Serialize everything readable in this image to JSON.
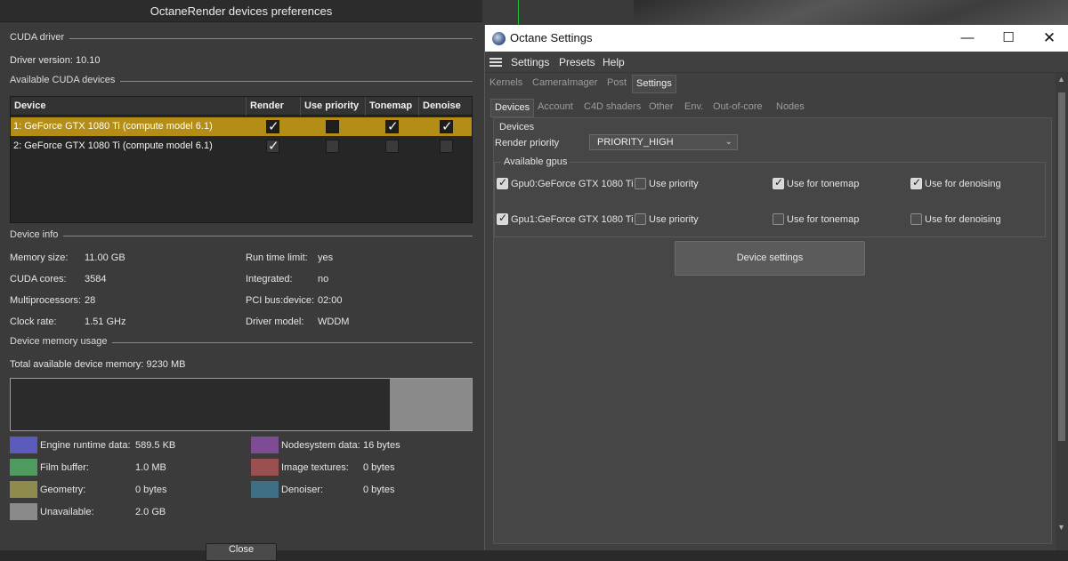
{
  "left_dialog": {
    "title": "OctaneRender devices preferences",
    "sections": {
      "cuda_driver": "CUDA driver",
      "available_devices": "Available CUDA devices",
      "device_info": "Device info",
      "memory_usage": "Device memory usage"
    },
    "driver_version": "Driver version:  10.10",
    "table": {
      "headers": [
        "Device",
        "Render",
        "Use priority",
        "Tonemap",
        "Denoise"
      ],
      "rows": [
        {
          "name": "1: GeForce GTX 1080 Ti (compute model 6.1)",
          "render": true,
          "priority": false,
          "tonemap": true,
          "denoise": true,
          "selected": true
        },
        {
          "name": "2: GeForce GTX 1080 Ti (compute model 6.1)",
          "render": true,
          "priority": false,
          "tonemap": false,
          "denoise": false,
          "selected": false
        }
      ]
    },
    "info": {
      "memory_label": "Memory size:",
      "memory_value": "11.00 GB",
      "cores_label": "CUDA cores:",
      "cores_value": "3584",
      "mp_label": "Multiprocessors:",
      "mp_value": "28",
      "clock_label": "Clock rate:",
      "clock_value": "1.51 GHz",
      "runtime_label": "Run time limit:",
      "runtime_value": "yes",
      "integrated_label": "Integrated:",
      "integrated_value": "no",
      "pci_label": "PCI bus:device:",
      "pci_value": "02:00",
      "driver_label": "Driver model:",
      "driver_value": "WDDM"
    },
    "total_memory": "Total available device memory:  9230 MB",
    "legend": [
      {
        "label": "Engine runtime data:",
        "value": "589.5 KB",
        "color": "#5b5bbd"
      },
      {
        "label": "Film buffer:",
        "value": "1.0 MB",
        "color": "#4f9a5e"
      },
      {
        "label": "Geometry:",
        "value": "0 bytes",
        "color": "#8f8a4e"
      },
      {
        "label": "Unavailable:",
        "value": "2.0 GB",
        "color": "#8a8a8a"
      },
      {
        "label": "Nodesystem data:",
        "value": "16 bytes",
        "color": "#7e4c94"
      },
      {
        "label": "Image textures:",
        "value": "0 bytes",
        "color": "#9a4f50"
      },
      {
        "label": "Denoiser:",
        "value": "0 bytes",
        "color": "#3f6f85"
      }
    ],
    "close_label": "Close"
  },
  "right_window": {
    "title": "Octane Settings",
    "menu": [
      "Settings",
      "Presets",
      "Help"
    ],
    "tabs_top": [
      "Kernels",
      "CameraImager",
      "Post",
      "Settings"
    ],
    "tabs_second": [
      "Devices",
      "Account",
      "C4D shaders",
      "Other",
      "Env.",
      "Out-of-core",
      "Nodes"
    ],
    "devices_label": "Devices",
    "render_priority_label": "Render priority",
    "render_priority_value": "PRIORITY_HIGH",
    "available_gpus_label": "Available gpus",
    "gpus": [
      {
        "name": "Gpu0:GeForce GTX 1080 Ti",
        "enabled": true,
        "priority": false,
        "tonemap": true,
        "denoise": true
      },
      {
        "name": "Gpu1:GeForce GTX 1080 Ti",
        "enabled": true,
        "priority": false,
        "tonemap": false,
        "denoise": false
      }
    ],
    "use_priority_label": "Use priority",
    "use_tonemap_label": "Use for tonemap",
    "use_denoise_label": "Use for denoising",
    "device_settings_label": "Device settings"
  }
}
